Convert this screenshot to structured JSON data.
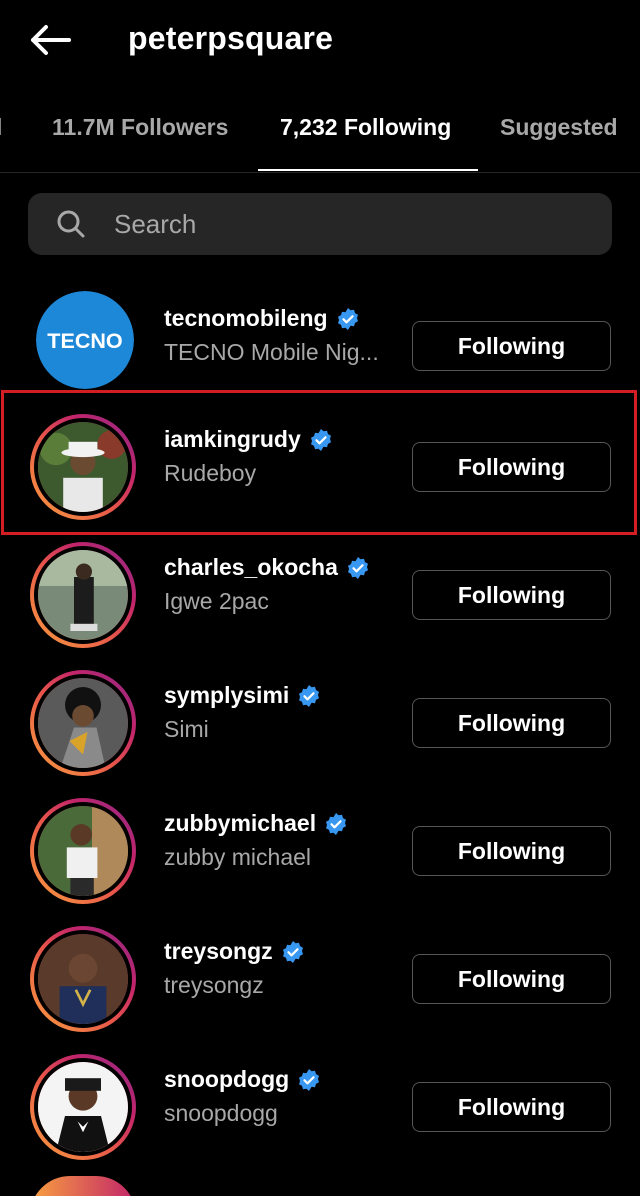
{
  "header": {
    "back_icon": "arrow-left-icon",
    "title": "peterpsquare"
  },
  "tabs": [
    {
      "label": "l",
      "active": false
    },
    {
      "label": "11.7M Followers",
      "active": false
    },
    {
      "label": "7,232 Following",
      "active": true
    },
    {
      "label": "Suggested",
      "active": false
    }
  ],
  "search": {
    "icon": "search-icon",
    "placeholder": "Search"
  },
  "list": [
    {
      "username": "tecnomobileng",
      "name": "TECNO Mobile Nig...",
      "verified": true,
      "button": "Following",
      "avatar_text": "TECNO"
    },
    {
      "username": "iamkingrudy",
      "name": "Rudeboy",
      "verified": true,
      "button": "Following"
    },
    {
      "username": "charles_okocha",
      "name": "Igwe 2pac",
      "verified": true,
      "button": "Following"
    },
    {
      "username": "symplysimi",
      "name": "Simi",
      "verified": true,
      "button": "Following"
    },
    {
      "username": "zubbymichael",
      "name": "zubby michael",
      "verified": true,
      "button": "Following"
    },
    {
      "username": "treysongz",
      "name": "treysongz",
      "verified": true,
      "button": "Following"
    },
    {
      "username": "snoopdogg",
      "name": "snoopdogg",
      "verified": true,
      "button": "Following"
    }
  ],
  "colors": {
    "background": "#000000",
    "secondary_text": "#a8a8a8",
    "verified_blue": "#3897f0",
    "highlight_red": "#d31f24",
    "tecno_blue": "#1e88d8"
  }
}
